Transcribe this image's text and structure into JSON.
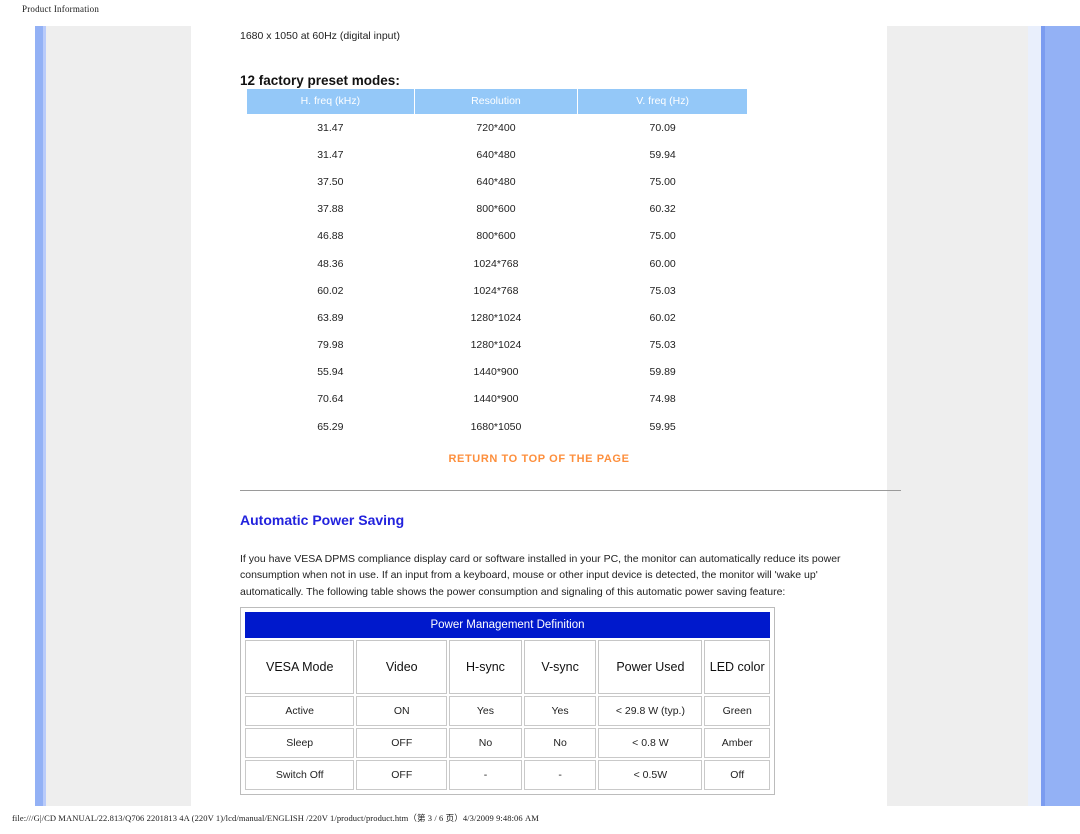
{
  "browser_frame": {
    "header_title": "Product Information",
    "footer_path": "file:///G|/CD MANUAL/22.813/Q706 2201813 4A (220V 1)/lcd/manual/ENGLISH /220V 1/product/product.htm（第 3 / 6 页）4/3/2009 9:48:06 AM"
  },
  "colors": {
    "preset_header_bg": "#94c8f8",
    "pm_title_bg": "#0019cc",
    "link_orange": "#fd8f3d",
    "heading_blue": "#2222dd",
    "rail_blue": "#93b1f5",
    "panel_gray": "#eeeeee"
  },
  "content": {
    "mode_line": "1680 x 1050 at 60Hz (digital input)",
    "preset_heading": "12 factory preset modes:",
    "return_link": "RETURN TO TOP OF THE PAGE",
    "aps_heading": "Automatic Power Saving",
    "aps_paragraph": "If you have VESA DPMS compliance display card or software installed in your PC, the monitor can automatically reduce its power consumption when not in use. If an input from a keyboard, mouse or other input device is detected, the monitor will 'wake up' automatically. The following table shows the power consumption and signaling of this automatic power saving feature:"
  },
  "preset_table": {
    "columns": [
      "H. freq (kHz)",
      "Resolution",
      "V. freq (Hz)"
    ],
    "rows": [
      [
        "31.47",
        "720*400",
        "70.09"
      ],
      [
        "31.47",
        "640*480",
        "59.94"
      ],
      [
        "37.50",
        "640*480",
        "75.00"
      ],
      [
        "37.88",
        "800*600",
        "60.32"
      ],
      [
        "46.88",
        "800*600",
        "75.00"
      ],
      [
        "48.36",
        "1024*768",
        "60.00"
      ],
      [
        "60.02",
        "1024*768",
        "75.03"
      ],
      [
        "63.89",
        "1280*1024",
        "60.02"
      ],
      [
        "79.98",
        "1280*1024",
        "75.03"
      ],
      [
        "55.94",
        "1440*900",
        "59.89"
      ],
      [
        "70.64",
        "1440*900",
        "74.98"
      ],
      [
        "65.29",
        "1680*1050",
        "59.95"
      ]
    ]
  },
  "power_table": {
    "title": "Power Management Definition",
    "columns": [
      "VESA Mode",
      "Video",
      "H-sync",
      "V-sync",
      "Power Used",
      "LED color"
    ],
    "rows": [
      [
        "Active",
        "ON",
        "Yes",
        "Yes",
        "< 29.8 W (typ.)",
        "Green"
      ],
      [
        "Sleep",
        "OFF",
        "No",
        "No",
        "< 0.8 W",
        "Amber"
      ],
      [
        "Switch Off",
        "OFF",
        "-",
        "-",
        "< 0.5W",
        "Off"
      ]
    ]
  }
}
